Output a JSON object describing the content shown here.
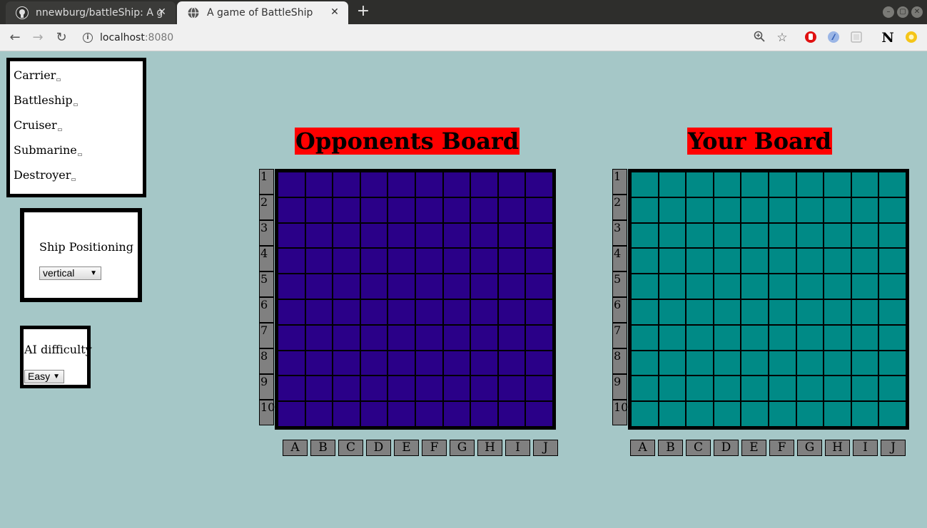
{
  "browser": {
    "tabs": [
      {
        "title": "nnewburg/battleShip: A g",
        "close": "✕",
        "active": false
      },
      {
        "title": "A game of BattleShip",
        "close": "✕",
        "active": true
      }
    ],
    "new_tab": "+",
    "window_buttons": [
      "–",
      "▢",
      "✕"
    ],
    "url_host": "localhost",
    "url_port": ":8080",
    "nav": {
      "back": "←",
      "forward": "→",
      "reload": "↻"
    },
    "toolbar_icons": [
      "zoom-icon",
      "star-icon",
      "extension-red-icon",
      "extension-blue-icon",
      "extension-grey-icon",
      "notion-icon",
      "extension-yellow-icon"
    ]
  },
  "ships": {
    "items": [
      "Carrier",
      "Battleship",
      "Cruiser",
      "Submarine",
      "Destroyer"
    ]
  },
  "positioning": {
    "label": "Ship Positioning",
    "selected": "vertical"
  },
  "ai": {
    "label": "AI difficulty",
    "selected": "Easy"
  },
  "opponent_board": {
    "title": "Opponents Board",
    "color": "#2a0088"
  },
  "player_board": {
    "title": "Your Board",
    "color": "#008a86"
  },
  "rows": [
    "1",
    "2",
    "3",
    "4",
    "5",
    "6",
    "7",
    "8",
    "9",
    "10"
  ],
  "columns": [
    "A",
    "B",
    "C",
    "D",
    "E",
    "F",
    "G",
    "H",
    "I",
    "J"
  ],
  "colors": {
    "page_bg": "#a5c7c7",
    "title_bg": "#ff0000",
    "label_bg": "#808080"
  }
}
